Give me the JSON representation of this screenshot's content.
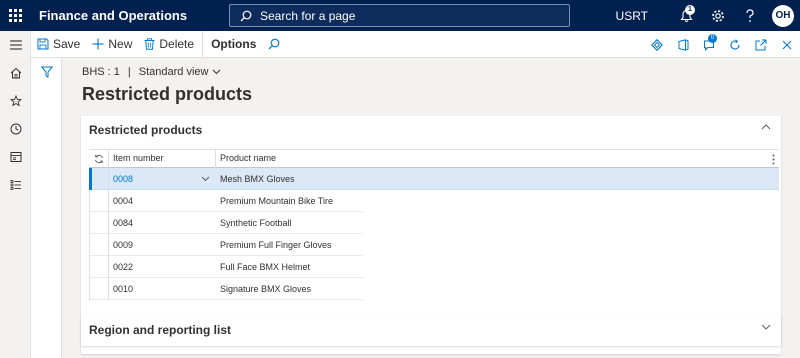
{
  "topbar": {
    "app_title": "Finance and Operations",
    "search_placeholder": "Search for a page",
    "company": "USRT",
    "notification_count": "1",
    "avatar_initials": "OH",
    "background": "#002050"
  },
  "actionpane": {
    "save": "Save",
    "new": "New",
    "delete": "Delete",
    "options": "Options",
    "message_count": "0"
  },
  "breadcrumb": {
    "record": "BHS : 1",
    "separator": "|",
    "view": "Standard view"
  },
  "page": {
    "title": "Restricted products"
  },
  "restricted_section": {
    "title": "Restricted products",
    "columns": {
      "item_number": "Item number",
      "product_name": "Product name"
    },
    "rows": [
      {
        "item": "0008",
        "name": "Mesh BMX Gloves"
      },
      {
        "item": "0004",
        "name": "Premium Mountain Bike Tire"
      },
      {
        "item": "0084",
        "name": "Synthetic Football"
      },
      {
        "item": "0009",
        "name": "Premium Full Finger Gloves"
      },
      {
        "item": "0022",
        "name": "Full Face BMX Helmet"
      },
      {
        "item": "0010",
        "name": "Signature BMX Gloves"
      }
    ]
  },
  "region_section": {
    "title": "Region and reporting list"
  },
  "colors": {
    "accent": "#0078d4",
    "selected_row": "#dae8f7"
  }
}
